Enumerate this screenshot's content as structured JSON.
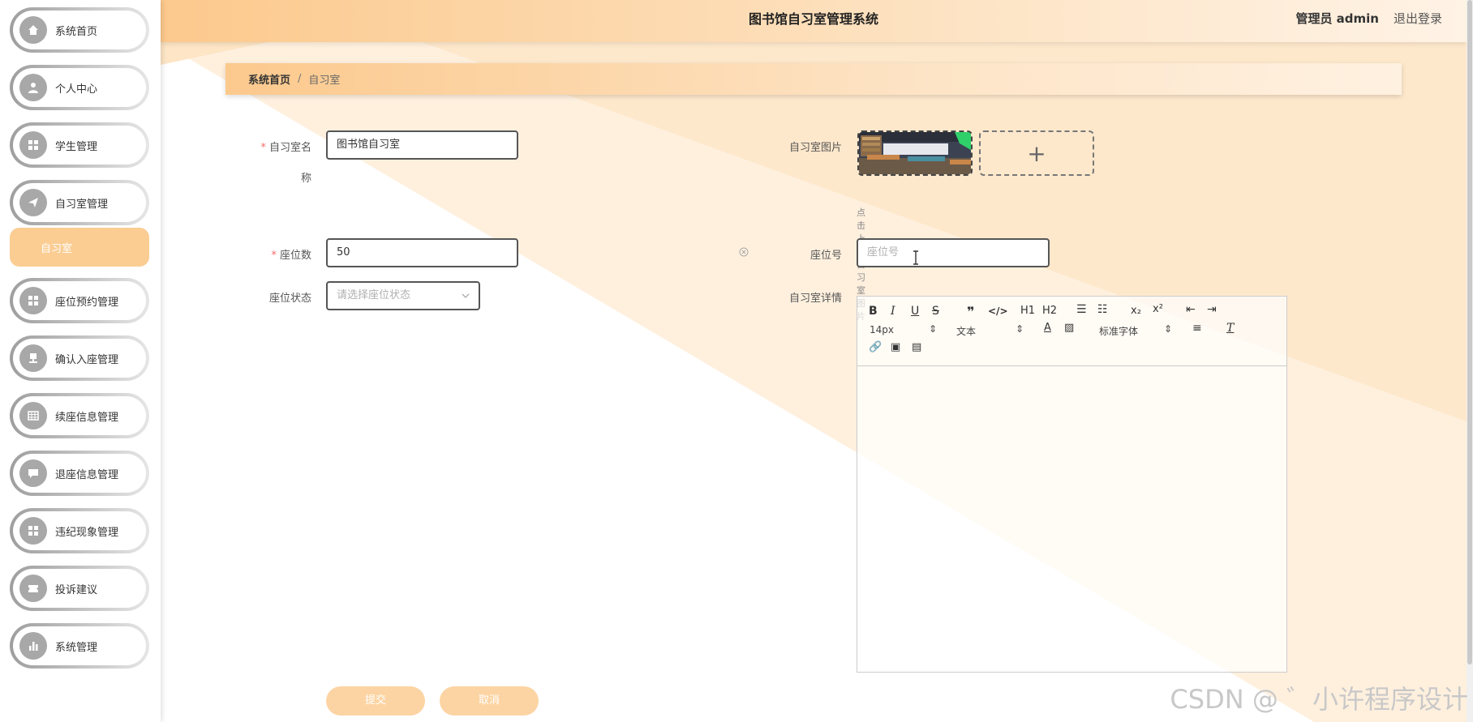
{
  "header": {
    "title": "图书馆自习室管理系统",
    "user": "管理员 admin",
    "logout": "退出登录"
  },
  "sidebar": {
    "items": [
      {
        "label": "系统首页",
        "icon": "home-icon"
      },
      {
        "label": "个人中心",
        "icon": "user-icon"
      },
      {
        "label": "学生管理",
        "icon": "grid-icon"
      },
      {
        "label": "自习室管理",
        "icon": "send-icon"
      },
      {
        "label": "座位预约管理",
        "icon": "grid-icon"
      },
      {
        "label": "确认入座管理",
        "icon": "stamp-icon"
      },
      {
        "label": "续座信息管理",
        "icon": "table-icon"
      },
      {
        "label": "退座信息管理",
        "icon": "chat-icon"
      },
      {
        "label": "违纪现象管理",
        "icon": "grid-icon"
      },
      {
        "label": "投诉建议",
        "icon": "ticket-icon"
      },
      {
        "label": "系统管理",
        "icon": "bar-chart-icon"
      }
    ],
    "active_sub": "自习室"
  },
  "breadcrumb": {
    "home": "系统首页",
    "sep": "/",
    "current": "自习室"
  },
  "form": {
    "name_label_1": "自习室名",
    "name_label_2": "称",
    "name_value": "图书馆自习室",
    "seats_label": "座位数",
    "seats_value": "50",
    "status_label": "座位状态",
    "status_placeholder": "请选择座位状态",
    "image_label": "自习室图片",
    "image_hint": "点击上传自习室图片",
    "seat_no_label": "座位号",
    "seat_no_placeholder": "座位号",
    "detail_label": "自习室详情",
    "submit": "提交",
    "cancel": "取消"
  },
  "editor": {
    "font_size": "14px",
    "block_type": "文本",
    "font_family": "标准字体",
    "h1": "H1",
    "h2": "H2"
  },
  "watermark": "CSDN @ ゛小许程序设计",
  "colors": {
    "accent": "#fbcd93",
    "header_from": "#fcc98d",
    "bg_tint": "#fff0de"
  }
}
